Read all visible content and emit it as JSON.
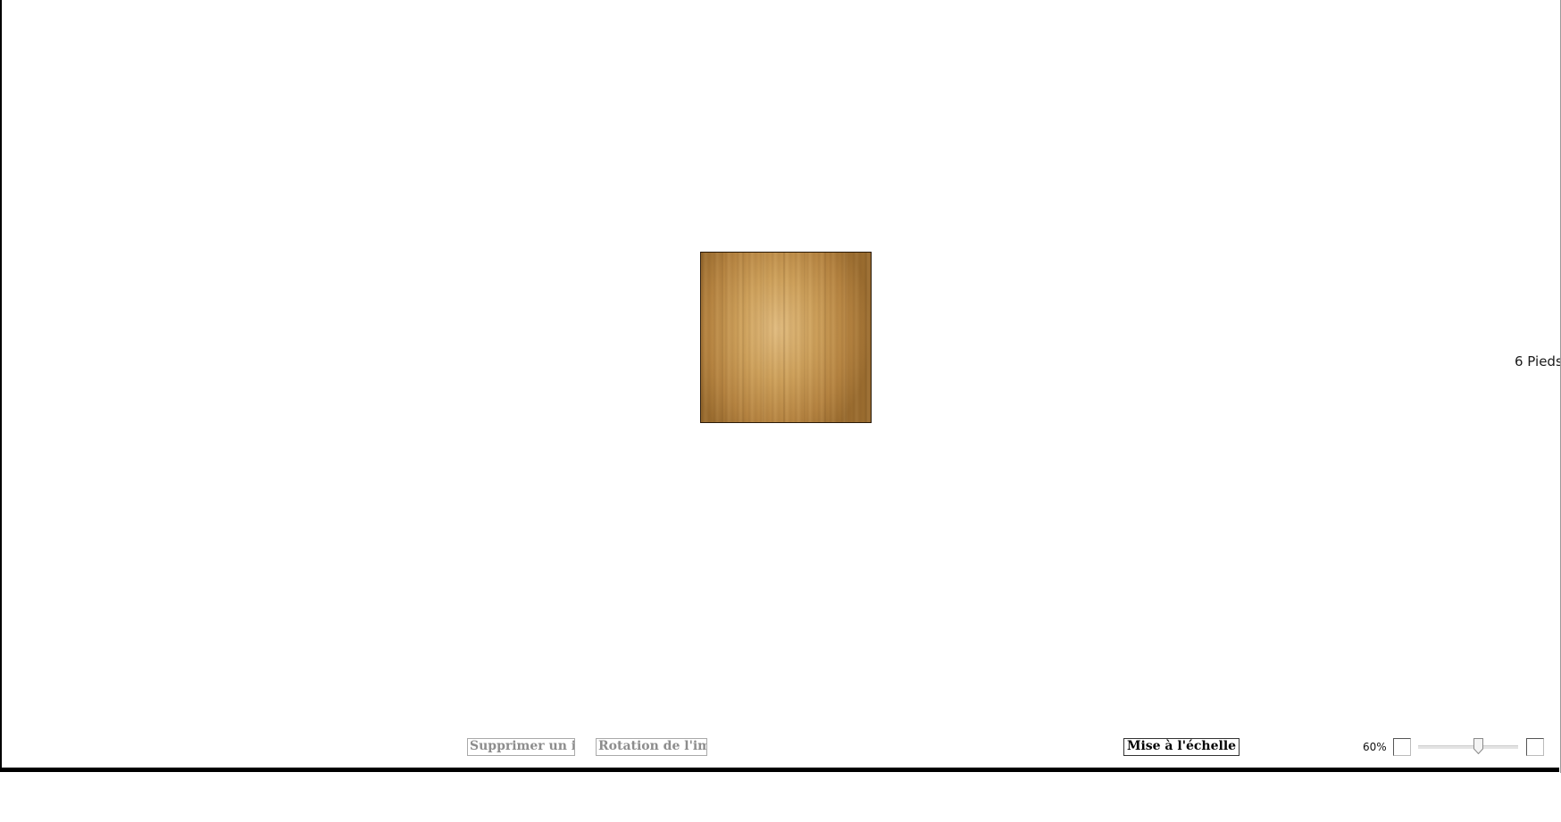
{
  "canvas": {
    "item": {
      "name": "wood-floor-tile",
      "texture": "bamboo-wood"
    },
    "scale_label": "6 Pieds"
  },
  "toolbar": {
    "delete_item_label": "Supprimer un ite",
    "rotate_image_label": "Rotation de l'ima",
    "scale_label": "Mise à l'échelle"
  },
  "zoom": {
    "label": "60%",
    "value_percent": 60,
    "slider_fraction": 0.6
  },
  "colors": {
    "frame_border": "#000000",
    "disabled_text": "#8d8d8d",
    "wood_light": "#e2bd81",
    "wood_dark": "#9a6c2f"
  }
}
